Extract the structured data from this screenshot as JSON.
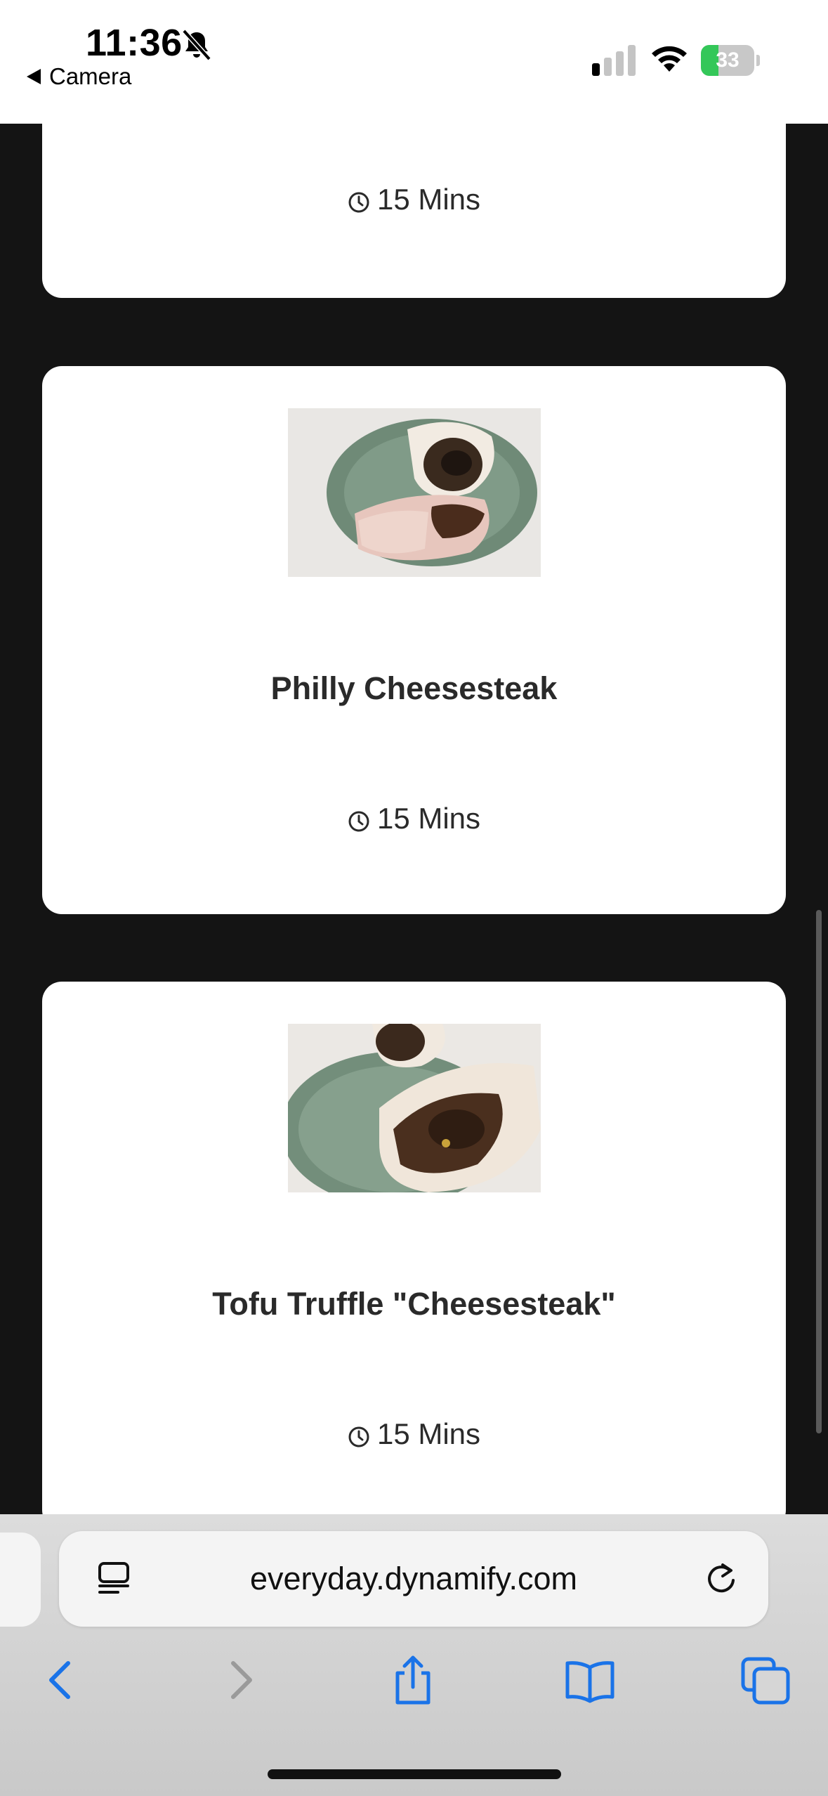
{
  "status_bar": {
    "time": "11:36",
    "back_label": "Camera",
    "battery_percent": "33",
    "battery_level": 0.33,
    "icons": [
      "bell-slash-icon",
      "cellular-signal-icon",
      "wifi-icon",
      "battery-charging-icon"
    ]
  },
  "cards": [
    {
      "title": "",
      "time": "15 Mins"
    },
    {
      "title": "Philly Cheesesteak",
      "time": "15 Mins",
      "image": "philly-cheesesteak-photo"
    },
    {
      "title": "Tofu Truffle \"Cheesesteak\"",
      "time": "15 Mins",
      "image": "tofu-truffle-cheesesteak-photo"
    }
  ],
  "browser": {
    "url": "everyday.dynamify.com",
    "icons": [
      "page-menu-icon",
      "reload-icon",
      "back-icon",
      "forward-icon",
      "share-icon",
      "bookmarks-icon",
      "tabs-icon"
    ]
  },
  "colors": {
    "page_background": "#141414",
    "card_background": "#ffffff",
    "accent_blue": "#1a73e8",
    "battery_green": "#34c759"
  }
}
